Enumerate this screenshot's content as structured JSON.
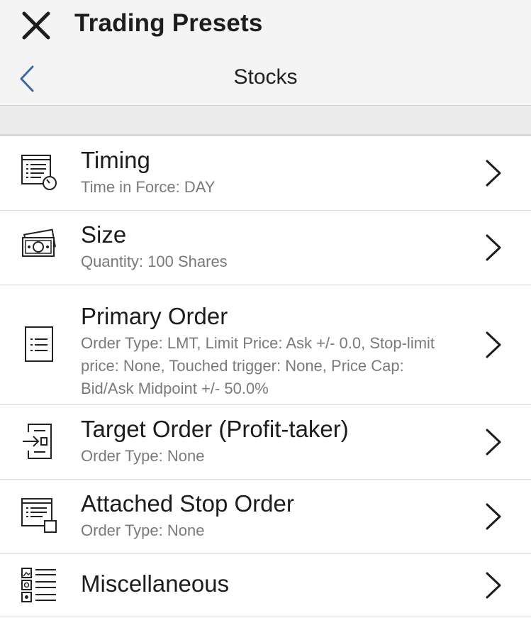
{
  "header": {
    "title": "Trading Presets",
    "close_icon": "close-icon"
  },
  "nav": {
    "title": "Stocks",
    "back_icon": "chevron-left-icon"
  },
  "items": [
    {
      "title": "Timing",
      "subtitle": "Time in Force: DAY",
      "icon": "timing-icon"
    },
    {
      "title": "Size",
      "subtitle": "Quantity: 100 Shares",
      "icon": "cash-icon"
    },
    {
      "title": "Primary Order",
      "subtitle": "Order Type: LMT, Limit Price: Ask +/- 0.0, Stop-limit price: None, Touched trigger: None, Price Cap: Bid/Ask Midpoint +/- 50.0%",
      "icon": "order-document-icon"
    },
    {
      "title": "Target Order (Profit-taker)",
      "subtitle": "Order Type: None",
      "icon": "target-order-icon"
    },
    {
      "title": "Attached Stop Order",
      "subtitle": "Order Type: None",
      "icon": "stop-order-icon"
    },
    {
      "title": "Miscellaneous",
      "subtitle": "",
      "icon": "miscellaneous-icon"
    }
  ],
  "colors": {
    "accent": "#3c6aa8",
    "header_bg": "#f4f4f4",
    "divider": "#dcdcdc",
    "subtitle": "#7a7a7a"
  }
}
